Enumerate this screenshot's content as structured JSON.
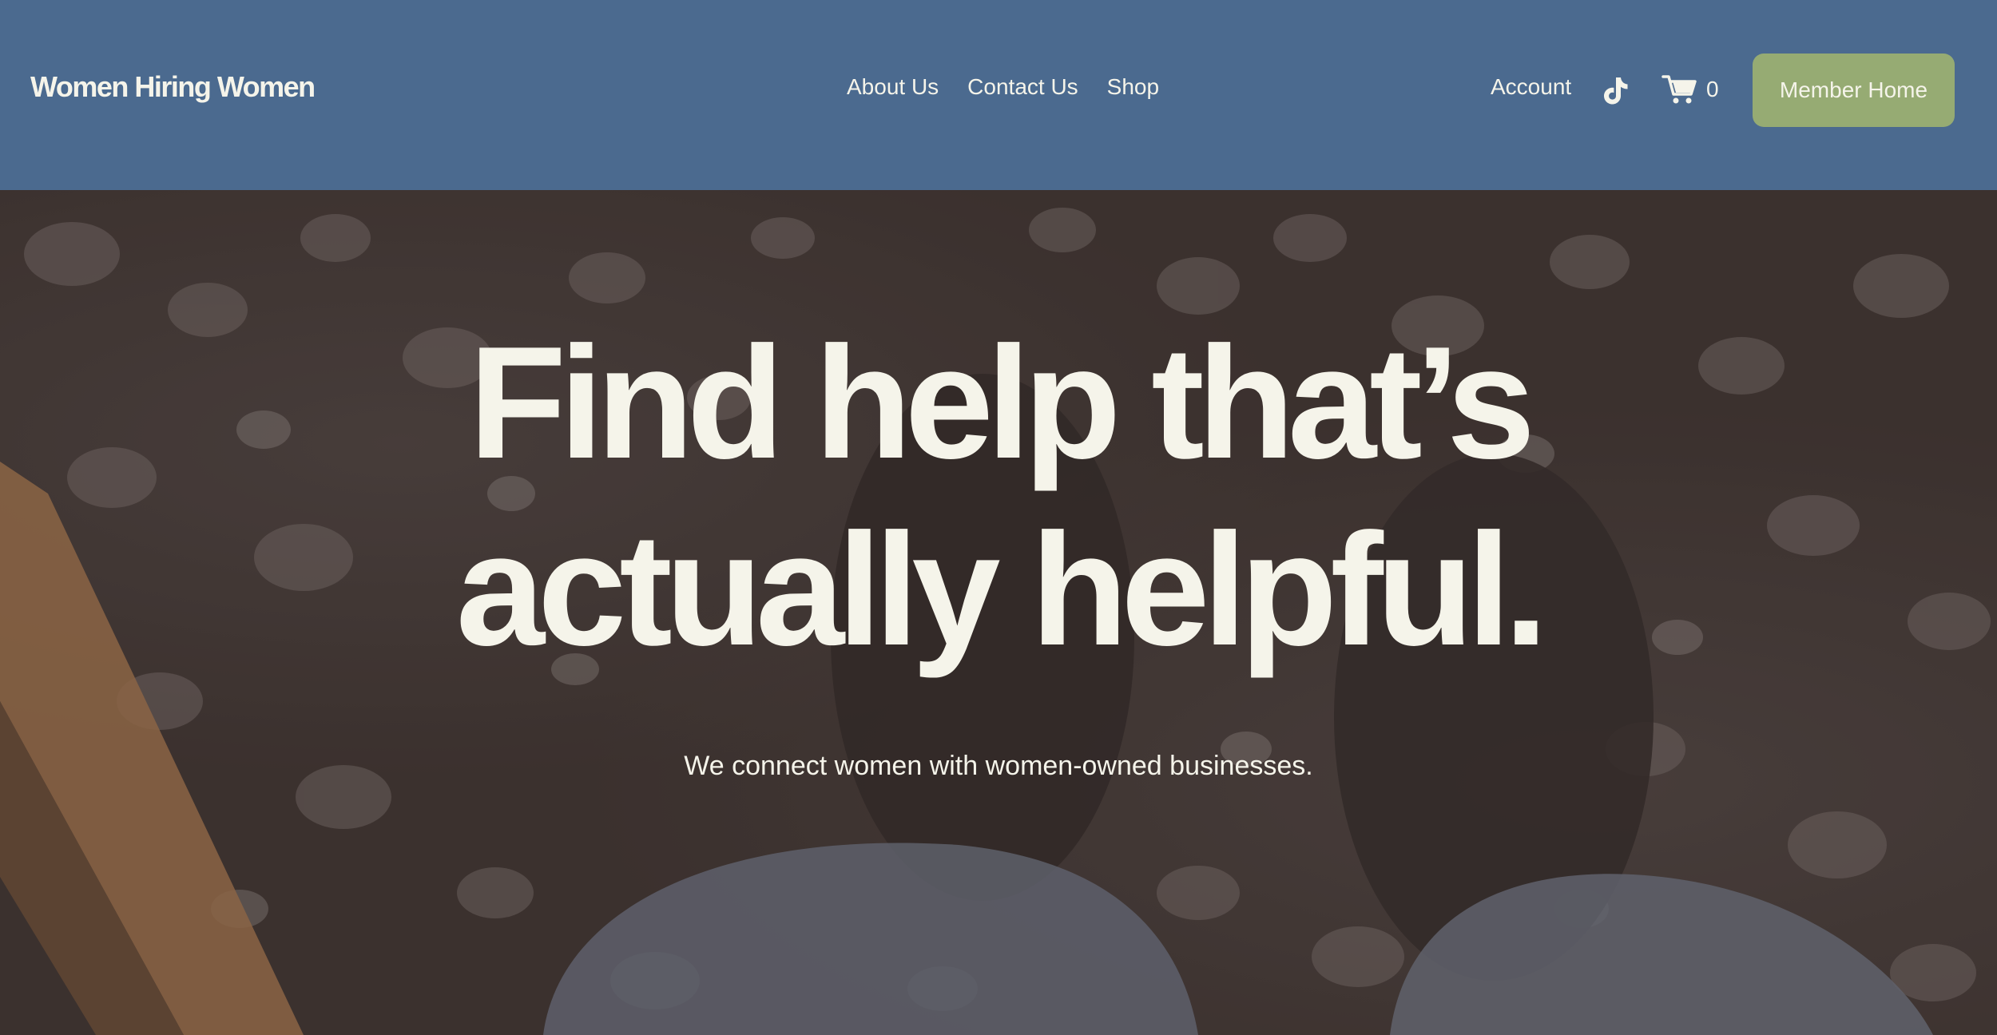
{
  "header": {
    "logo": "Women Hiring Women",
    "nav": [
      "About Us",
      "Contact Us",
      "Shop"
    ],
    "account_label": "Account",
    "cart_count": "0",
    "member_button": "Member Home"
  },
  "hero": {
    "headline_line1": "Find help that’s",
    "headline_line2": "actually helpful.",
    "subheadline": "We connect women with women-owned businesses."
  },
  "colors": {
    "header_bg": "#4b6a8f",
    "button_bg": "#96ab73",
    "text_light": "#f5f4ea"
  },
  "icons": [
    "tiktok-icon",
    "cart-icon"
  ]
}
